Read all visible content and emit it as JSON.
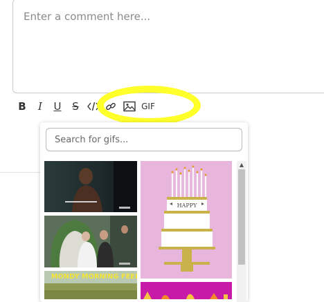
{
  "comment": {
    "placeholder": "Enter a comment here..."
  },
  "toolbar": {
    "bold": "B",
    "italic": "I",
    "underline": "U",
    "strike": "S",
    "gif_label": "GIF",
    "highlight_color": "#ffff2a"
  },
  "gif_picker": {
    "search_placeholder": "Search for gifs...",
    "items": [
      {
        "id": "gif-1",
        "icon": "tv-scene-thumbnail"
      },
      {
        "id": "gif-2",
        "icon": "happy-birthday-cake"
      },
      {
        "id": "gif-3",
        "icon": "wedding-scene-thumbnail"
      },
      {
        "id": "gif-4",
        "caption": "MONDY MORNING FEELING"
      },
      {
        "id": "gif-5",
        "icon": "pink-banner-thumbnail"
      }
    ]
  }
}
